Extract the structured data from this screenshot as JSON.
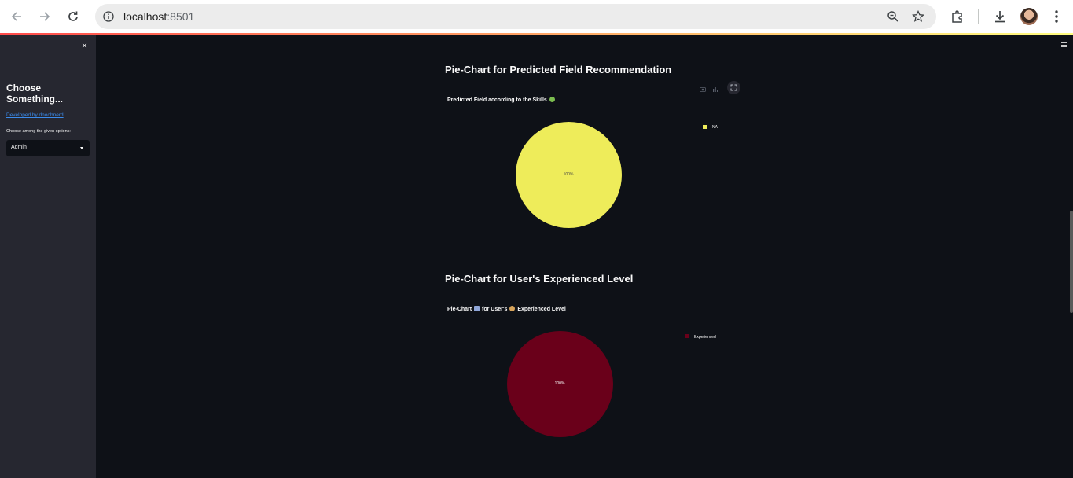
{
  "browser": {
    "url_host": "localhost",
    "url_port": ":8501",
    "icons": [
      "back-icon",
      "forward-icon",
      "reload-icon",
      "site-info-icon",
      "zoom-icon",
      "bookmark-star-icon",
      "extensions-icon",
      "download-icon",
      "profile-avatar",
      "more-menu-icon"
    ]
  },
  "sidebar": {
    "close_glyph": "×",
    "title": "Choose Something...",
    "link_text": "Developed by dnoobnerd",
    "select_label": "Choose among the given options:",
    "select_value": "Admin"
  },
  "main": {
    "sections": [
      {
        "heading": "Pie-Chart for Predicted Field Recommendation",
        "chart_title_text": "Predicted Field according to the Skills",
        "chart_title_emoji": "nerd-face-emoji",
        "legend": "NA",
        "slice_label": "100%",
        "color": "#eeec5a",
        "label_color": "#444444"
      },
      {
        "heading": "Pie-Chart for User's Experienced Level",
        "chart_title_part1": "Pie-Chart",
        "chart_title_part2": "for User's",
        "chart_title_part3": "Experienced Level",
        "chart_title_emoji1": "chart-emoji",
        "chart_title_emoji2": "person-emoji",
        "legend": "Experienced",
        "slice_label": "100%",
        "color": "#6a001a",
        "label_color": "#fafafa"
      }
    ]
  },
  "chart_data": [
    {
      "type": "pie",
      "title": "Predicted Field according to the Skills",
      "categories": [
        "NA"
      ],
      "values": [
        100
      ],
      "slice_labels": [
        "100%"
      ],
      "colors": [
        "#eeec5a"
      ],
      "legend_position": "top-right"
    },
    {
      "type": "pie",
      "title": "Pie-Chart for User's Experienced Level",
      "categories": [
        "Experienced"
      ],
      "values": [
        100
      ],
      "slice_labels": [
        "100%"
      ],
      "colors": [
        "#6a001a"
      ],
      "legend_position": "top-right"
    }
  ]
}
